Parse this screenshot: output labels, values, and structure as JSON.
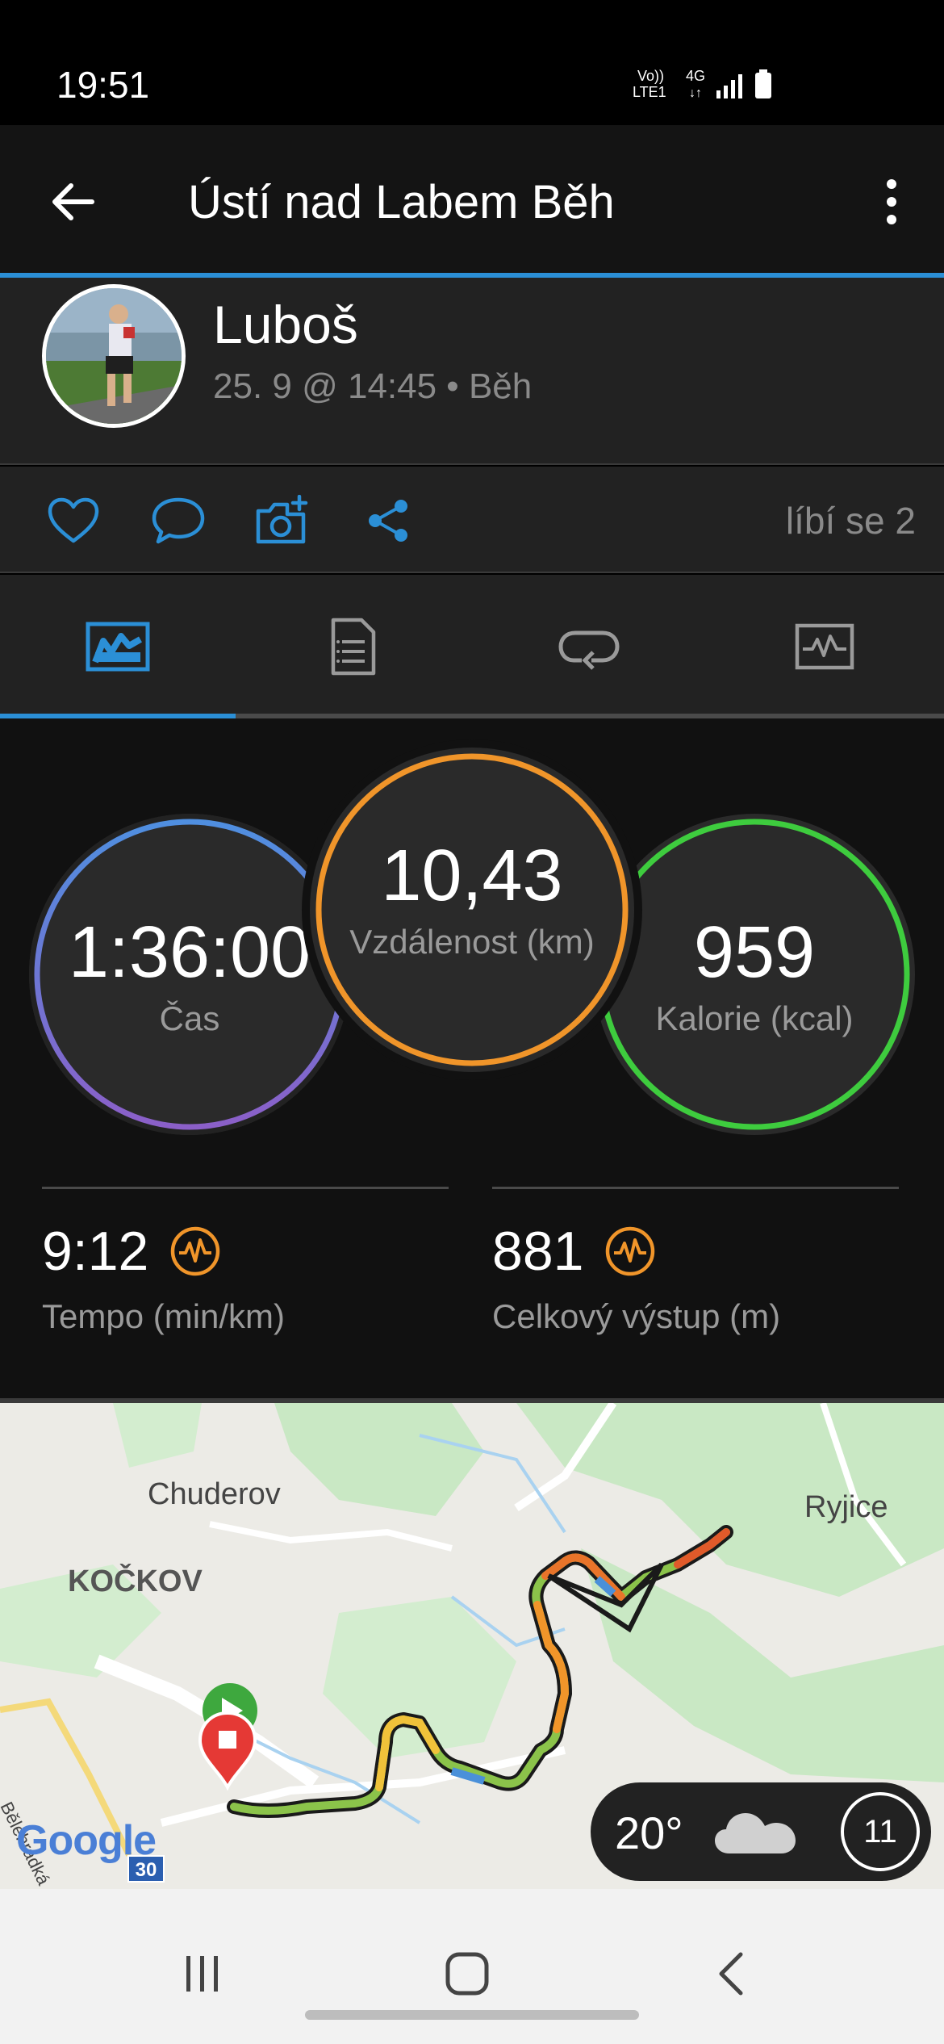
{
  "status": {
    "time": "19:51",
    "network_top": "Vo))",
    "network_bottom": "LTE1",
    "network_type": "4G"
  },
  "header": {
    "title": "Ústí nad Labem Běh"
  },
  "user": {
    "name": "Luboš",
    "meta": "25. 9 @ 14:45 • Běh"
  },
  "actions": {
    "likes": "líbí se 2"
  },
  "stats": {
    "time": {
      "value": "1:36:00",
      "label": "Čas"
    },
    "distance": {
      "value": "10,43",
      "label": "Vzdálenost (km)"
    },
    "calories": {
      "value": "959",
      "label": "Kalorie (kcal)"
    },
    "pace": {
      "value": "9:12",
      "label": "Tempo (min/km)"
    },
    "ascent": {
      "value": "881",
      "label": "Celkový výstup (m)"
    }
  },
  "map": {
    "labels": {
      "chuderov": "Chuderov",
      "kockov": "KOČKOV",
      "ryjice": "Ryjice",
      "street": "Bělehrádká",
      "road": "30"
    },
    "google": "Google",
    "weather": {
      "temp": "20°",
      "wind": "11"
    }
  },
  "colors": {
    "accent": "#2b8fd6",
    "time_ring": "#5a8fd6",
    "distance_ring": "#f0952a",
    "calories_ring": "#3ecc3e",
    "icon_orange": "#f0952a"
  }
}
